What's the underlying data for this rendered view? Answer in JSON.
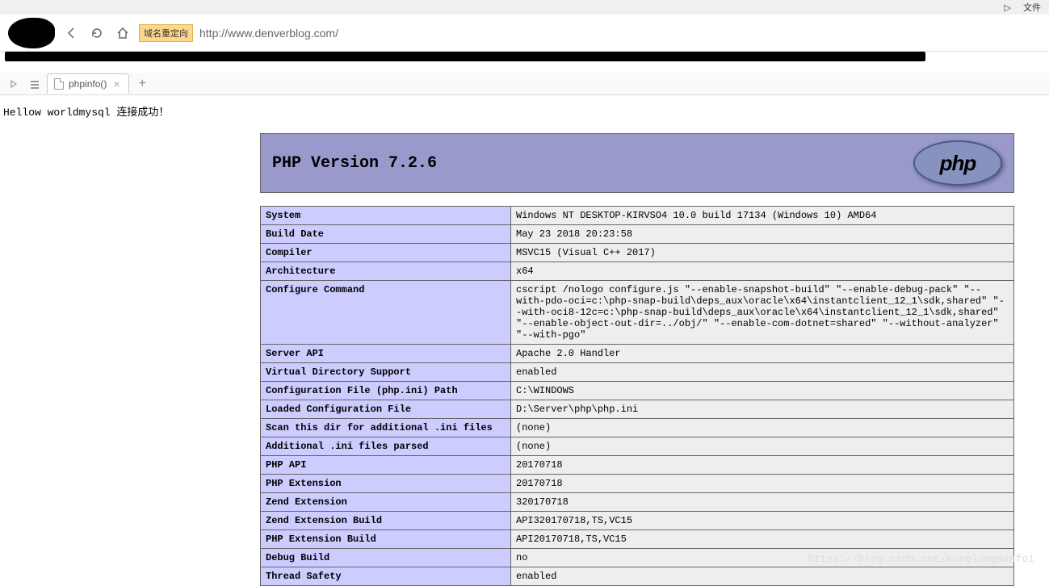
{
  "top_menu": {
    "play_icon": "▷",
    "file": "文件"
  },
  "browser": {
    "url_prefix": "域名重定向",
    "url": "http://www.denverblog.com/"
  },
  "tab": {
    "title": "phpinfo()"
  },
  "page": {
    "hello": "Hellow worldmysql 连接成功！"
  },
  "php": {
    "version_label": "PHP Version 7.2.6",
    "logo_text": "php",
    "rows": [
      {
        "k": "System",
        "v": "Windows NT DESKTOP-KIRVSO4 10.0 build 17134 (Windows 10) AMD64"
      },
      {
        "k": "Build Date",
        "v": "May 23 2018 20:23:58"
      },
      {
        "k": "Compiler",
        "v": "MSVC15 (Visual C++ 2017)"
      },
      {
        "k": "Architecture",
        "v": "x64"
      },
      {
        "k": "Configure Command",
        "v": "cscript /nologo configure.js \"--enable-snapshot-build\" \"--enable-debug-pack\" \"--with-pdo-oci=c:\\php-snap-build\\deps_aux\\oracle\\x64\\instantclient_12_1\\sdk,shared\" \"--with-oci8-12c=c:\\php-snap-build\\deps_aux\\oracle\\x64\\instantclient_12_1\\sdk,shared\" \"--enable-object-out-dir=../obj/\" \"--enable-com-dotnet=shared\" \"--without-analyzer\" \"--with-pgo\""
      },
      {
        "k": "Server API",
        "v": "Apache 2.0 Handler"
      },
      {
        "k": "Virtual Directory Support",
        "v": "enabled"
      },
      {
        "k": "Configuration File (php.ini) Path",
        "v": "C:\\WINDOWS"
      },
      {
        "k": "Loaded Configuration File",
        "v": "D:\\Server\\php\\php.ini"
      },
      {
        "k": "Scan this dir for additional .ini files",
        "v": "(none)"
      },
      {
        "k": "Additional .ini files parsed",
        "v": "(none)"
      },
      {
        "k": "PHP API",
        "v": "20170718"
      },
      {
        "k": "PHP Extension",
        "v": "20170718"
      },
      {
        "k": "Zend Extension",
        "v": "320170718"
      },
      {
        "k": "Zend Extension Build",
        "v": "API320170718,TS,VC15"
      },
      {
        "k": "PHP Extension Build",
        "v": "API20170718,TS,VC15"
      },
      {
        "k": "Debug Build",
        "v": "no"
      },
      {
        "k": "Thread Safety",
        "v": "enabled"
      }
    ]
  },
  "watermark": "https://blog.csdn.net/konglongdanfo1"
}
